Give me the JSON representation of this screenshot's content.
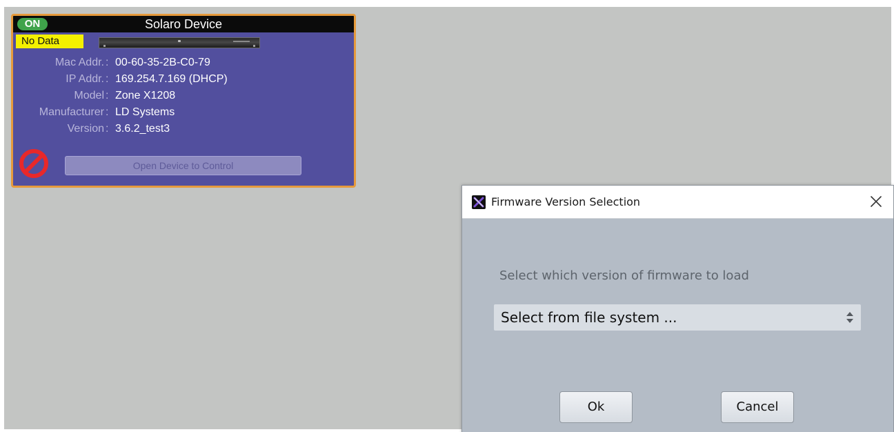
{
  "device_card": {
    "power_badge": "ON",
    "title": "Solaro Device",
    "status_badge": "No Data",
    "info": [
      {
        "label": "Mac Addr.",
        "value": "00-60-35-2B-C0-79"
      },
      {
        "label": "IP Addr.",
        "value": "169.254.7.169 (DHCP)"
      },
      {
        "label": "Model",
        "value": "Zone X1208"
      },
      {
        "label": "Manufacturer",
        "value": "LD Systems"
      },
      {
        "label": "Version",
        "value": "3.6.2_test3"
      }
    ],
    "separator": ":",
    "open_button_label": "Open Device to Control",
    "icons": {
      "status": "no-entry-icon",
      "device": "device-rack-icon"
    },
    "colors": {
      "border": "#e69a3c",
      "background": "#524f9e",
      "on": "#3fa34a",
      "no_data": "#f4f000",
      "no_entry": "#e8282a"
    }
  },
  "dialog": {
    "title": "Firmware Version Selection",
    "prompt": "Select which version of firmware to load",
    "select": {
      "value": "Select from file system ..."
    },
    "ok_label": "Ok",
    "cancel_label": "Cancel",
    "icons": {
      "app": "app-logo-icon",
      "close": "close-icon",
      "select": "up-down-arrows-icon"
    }
  }
}
